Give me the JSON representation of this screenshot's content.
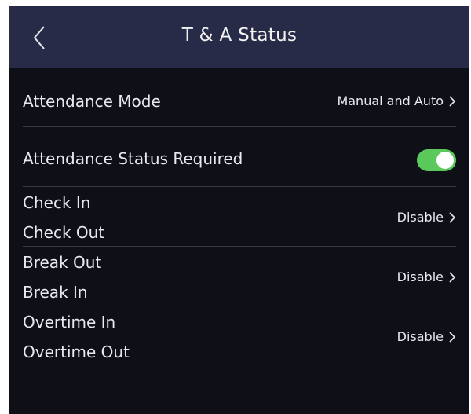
{
  "header": {
    "title": "T & A Status"
  },
  "rows": {
    "mode": {
      "label": "Attendance Mode",
      "value": "Manual and Auto"
    },
    "required": {
      "label": "Attendance Status Required",
      "enabled": true
    },
    "check": {
      "label1": "Check In",
      "label2": "Check Out",
      "value": "Disable"
    },
    "break": {
      "label1": "Break Out",
      "label2": "Break In",
      "value": "Disable"
    },
    "overtime": {
      "label1": "Overtime In",
      "label2": "Overtime Out",
      "value": "Disable"
    }
  },
  "colors": {
    "header_bg": "#272b47",
    "screen_bg": "#0f0f18",
    "toggle_on": "#5bc85b"
  },
  "icons": {
    "back": "chevron-left-icon",
    "row_arrow": "chevron-right-icon"
  }
}
